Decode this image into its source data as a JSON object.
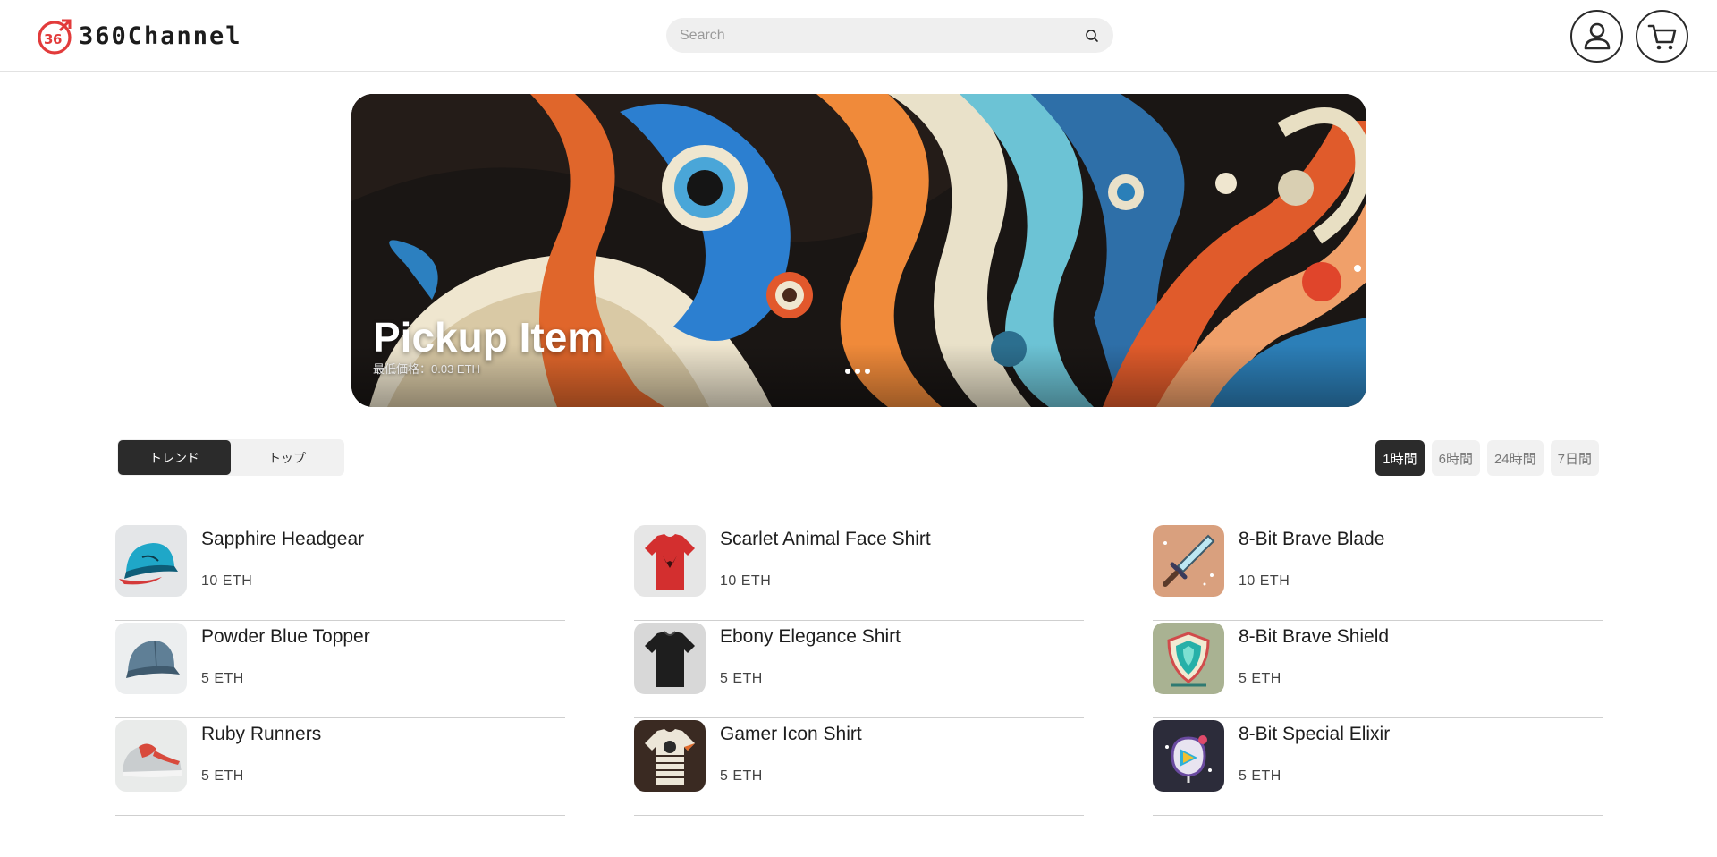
{
  "header": {
    "logo_text": "360Channel",
    "search_placeholder": "Search"
  },
  "hero": {
    "title": "Pickup Item",
    "subtitle": "最低価格：0.03 ETH",
    "slide_count": 3
  },
  "tabs": [
    {
      "label": "トレンド",
      "active": true
    },
    {
      "label": "トップ",
      "active": false
    }
  ],
  "periods": [
    {
      "label": "1時間",
      "active": true
    },
    {
      "label": "6時間",
      "active": false
    },
    {
      "label": "24時間",
      "active": false
    },
    {
      "label": "7日間",
      "active": false
    }
  ],
  "columns": [
    [
      {
        "name": "Sapphire Headgear",
        "price": "10 ETH",
        "icon": "cap-icon"
      },
      {
        "name": "Powder Blue Topper",
        "price": "5 ETH",
        "icon": "cap-icon"
      },
      {
        "name": "Ruby Runners",
        "price": "5 ETH",
        "icon": "sneaker-icon"
      }
    ],
    [
      {
        "name": "Scarlet Animal Face Shirt",
        "price": "10 ETH",
        "icon": "shirt-icon"
      },
      {
        "name": "Ebony Elegance Shirt",
        "price": "5 ETH",
        "icon": "shirt-icon"
      },
      {
        "name": "Gamer Icon Shirt",
        "price": "5 ETH",
        "icon": "shirt-icon"
      }
    ],
    [
      {
        "name": "8-Bit Brave Blade",
        "price": "10 ETH",
        "icon": "sword-icon"
      },
      {
        "name": "8-Bit Brave Shield",
        "price": "5 ETH",
        "icon": "shield-icon"
      },
      {
        "name": "8-Bit Special Elixir",
        "price": "5 ETH",
        "icon": "potion-icon"
      }
    ]
  ],
  "colors": {
    "accent_red": "#e23b3b",
    "dark": "#2b2b2b",
    "pill_bg": "#f1f1f1"
  }
}
